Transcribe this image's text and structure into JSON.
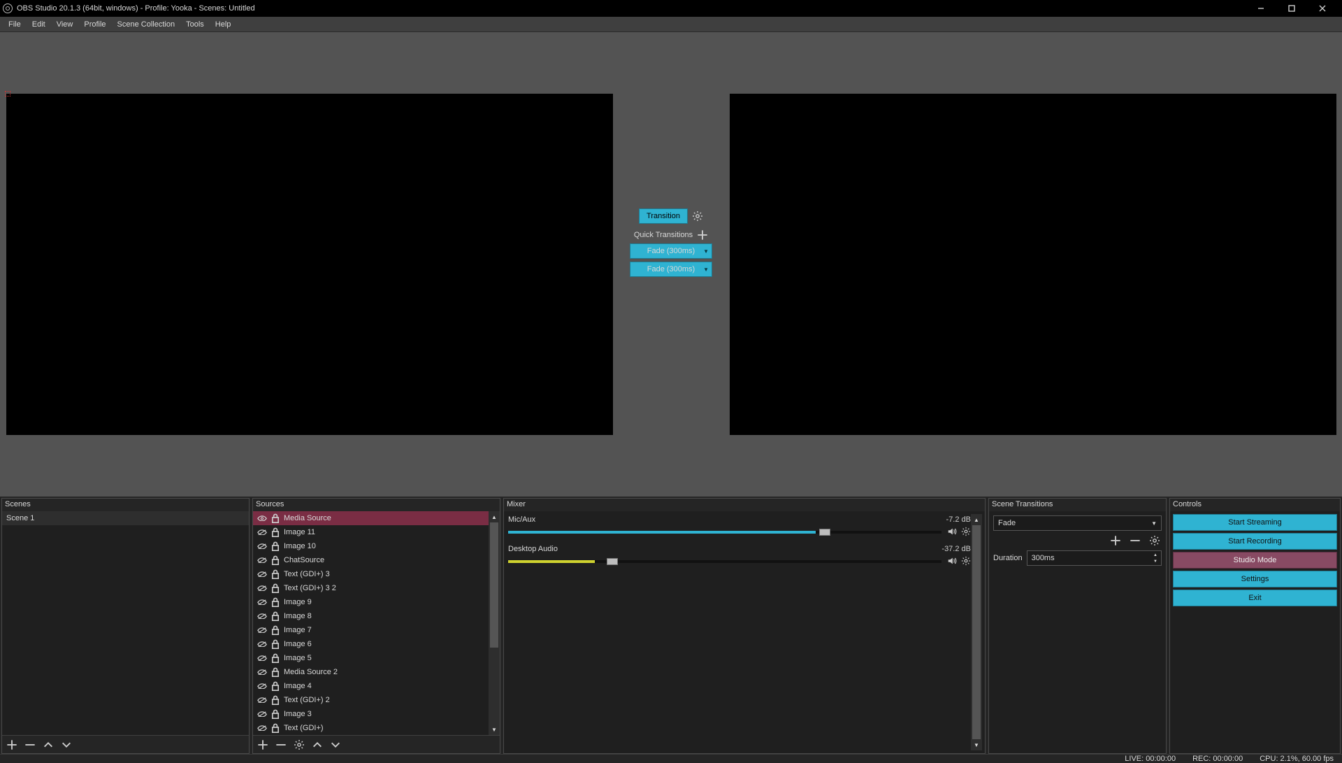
{
  "title": "OBS Studio 20.1.3 (64bit, windows) - Profile: Yooka - Scenes: Untitled",
  "menu": {
    "items": [
      "File",
      "Edit",
      "View",
      "Profile",
      "Scene Collection",
      "Tools",
      "Help"
    ]
  },
  "center": {
    "transition_btn": "Transition",
    "quick_label": "Quick Transitions",
    "fade1": "Fade (300ms)",
    "fade2": "Fade (300ms)"
  },
  "docks": {
    "scenes": {
      "title": "Scenes",
      "items": [
        "Scene 1"
      ]
    },
    "sources": {
      "title": "Sources",
      "items": [
        {
          "name": "Media Source",
          "visible": true,
          "selected": true
        },
        {
          "name": "Image 11",
          "visible": false
        },
        {
          "name": "Image 10",
          "visible": false
        },
        {
          "name": "ChatSource",
          "visible": false
        },
        {
          "name": "Text (GDI+) 3",
          "visible": false
        },
        {
          "name": "Text (GDI+) 3 2",
          "visible": false
        },
        {
          "name": "Image 9",
          "visible": false
        },
        {
          "name": "Image 8",
          "visible": false
        },
        {
          "name": "Image 7",
          "visible": false
        },
        {
          "name": "Image 6",
          "visible": false
        },
        {
          "name": "Image 5",
          "visible": false
        },
        {
          "name": "Media Source 2",
          "visible": false
        },
        {
          "name": "Image 4",
          "visible": false
        },
        {
          "name": "Text (GDI+) 2",
          "visible": false
        },
        {
          "name": "Image 3",
          "visible": false
        },
        {
          "name": "Text (GDI+)",
          "visible": false
        }
      ]
    },
    "mixer": {
      "title": "Mixer",
      "channels": [
        {
          "name": "Mic/Aux",
          "db": "-7.2 dB",
          "fill_pct": 71,
          "color": "teal",
          "knob_pct": 73
        },
        {
          "name": "Desktop Audio",
          "db": "-37.2 dB",
          "fill_pct": 20,
          "color": "yellow",
          "knob_pct": 24
        }
      ]
    },
    "transitions": {
      "title": "Scene Transitions",
      "combo": "Fade",
      "duration_label": "Duration",
      "duration_value": "300ms"
    },
    "controls": {
      "title": "Controls",
      "buttons": [
        {
          "label": "Start Streaming",
          "style": "normal"
        },
        {
          "label": "Start Recording",
          "style": "normal"
        },
        {
          "label": "Studio Mode",
          "style": "alt"
        },
        {
          "label": "Settings",
          "style": "normal"
        },
        {
          "label": "Exit",
          "style": "normal"
        }
      ]
    }
  },
  "status": {
    "live": "LIVE: 00:00:00",
    "rec": "REC: 00:00:00",
    "cpu": "CPU: 2.1%, 60.00 fps"
  }
}
